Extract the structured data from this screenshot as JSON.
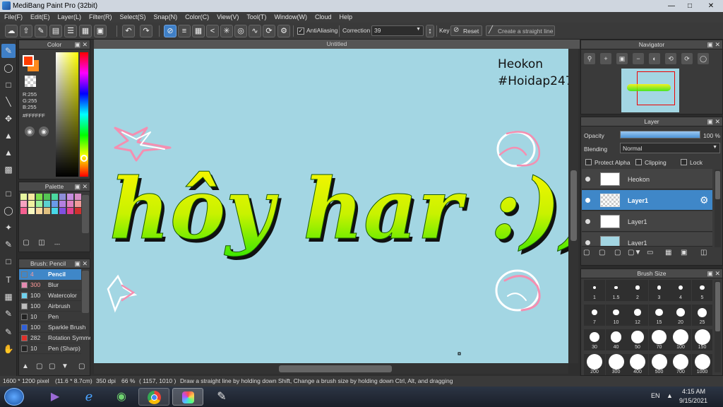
{
  "window": {
    "title": "MediBang Paint Pro (32bit)"
  },
  "menu": [
    "File(F)",
    "Edit(E)",
    "Layer(L)",
    "Filter(R)",
    "Select(S)",
    "Snap(N)",
    "Color(C)",
    "View(V)",
    "Tool(T)",
    "Window(W)",
    "Cloud",
    "Help"
  ],
  "toolbar": {
    "antialias_label": "AntiAliasing",
    "correction_label": "Correction",
    "correction_value": "39",
    "key_label": "Key",
    "reset_label": "Reset",
    "straight_line_label": "Create a straight line"
  },
  "color_panel": {
    "title": "Color",
    "r": "R:255",
    "g": "G:255",
    "b": "B:255",
    "hex": "#FFFFFF",
    "fg_color": "#ff3c00",
    "bg_color": "#ff8a1c"
  },
  "palette_panel": {
    "title": "Palette",
    "dash": "---"
  },
  "brush_panel": {
    "title": "Brush: Pencil",
    "items": [
      {
        "size": "4",
        "name": "Pencil",
        "color": "#3f87c8"
      },
      {
        "size": "300",
        "name": "Blur",
        "color": "#e58ab0"
      },
      {
        "size": "100",
        "name": "Watercolor",
        "color": "#6fd2ee"
      },
      {
        "size": "100",
        "name": "Airbrush",
        "color": "#bdbdbd"
      },
      {
        "size": "10",
        "name": "Pen",
        "color": "#222222"
      },
      {
        "size": "100",
        "name": "Sparkle Brush",
        "color": "#2f5fd8"
      },
      {
        "size": "282",
        "name": "Rotation Symmetry",
        "color": "#e0302a"
      },
      {
        "size": "10",
        "name": "Pen (Sharp)",
        "color": "#222222"
      }
    ]
  },
  "canvas": {
    "tab_title": "Untitled",
    "watermark_line1": "Heokon",
    "watermark_line2": "#Hoidap247",
    "artwork_text": "hôy har :)))"
  },
  "navigator": {
    "title": "Navigator"
  },
  "layer_panel": {
    "title": "Layer",
    "opacity_label": "Opacity",
    "opacity_value": "100 %",
    "opacity_level": 1.0,
    "blending_label": "Blending",
    "blending_value": "Normal",
    "protect_alpha_label": "Protect Alpha",
    "clipping_label": "Clipping",
    "lock_label": "Lock",
    "layers": [
      {
        "name": "Heokon"
      },
      {
        "name": "Layer1"
      },
      {
        "name": "Layer1"
      },
      {
        "name": "Layer1"
      }
    ]
  },
  "brush_size_panel": {
    "title": "Brush Size",
    "sizes": [
      "1",
      "1.5",
      "2",
      "3",
      "4",
      "5",
      "7",
      "10",
      "12",
      "15",
      "20",
      "25",
      "30",
      "40",
      "50",
      "70",
      "100",
      "150",
      "200",
      "300",
      "400",
      "500",
      "700",
      "1000"
    ]
  },
  "status": {
    "dimensions": "1600 * 1200 pixel",
    "cm": "(11.6 * 8.7cm)",
    "dpi": "350 dpi",
    "zoom": "66 %",
    "coords": "( 1157, 1010 )",
    "hint": "Draw a straight line by holding down Shift, Change a brush size by holding down Ctrl, Alt, and dragging"
  },
  "taskbar": {
    "lang": "EN",
    "time": "4:15 AM",
    "date": "9/15/2021"
  }
}
